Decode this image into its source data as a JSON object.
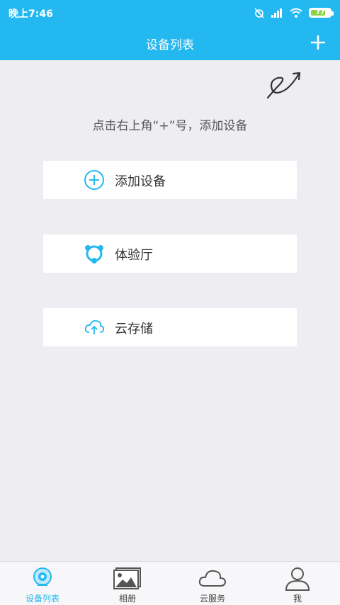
{
  "status_bar": {
    "time": "晚上7:46",
    "battery": "77"
  },
  "header": {
    "title": "设备列表"
  },
  "hint": "点击右上角“+”号，添加设备",
  "cards": [
    {
      "label": "添加设备",
      "icon": "plus-circle-icon"
    },
    {
      "label": "体验厅",
      "icon": "share-circle-icon"
    },
    {
      "label": "云存储",
      "icon": "cloud-upload-icon"
    }
  ],
  "tabs": [
    {
      "label": "设备列表",
      "icon": "camera-icon",
      "active": true
    },
    {
      "label": "相册",
      "icon": "photo-icon",
      "active": false
    },
    {
      "label": "云服务",
      "icon": "cloud-icon",
      "active": false
    },
    {
      "label": "我",
      "icon": "person-icon",
      "active": false
    }
  ],
  "colors": {
    "accent": "#24b8f0",
    "background": "#eeeef2",
    "battery": "#8fd24a"
  }
}
